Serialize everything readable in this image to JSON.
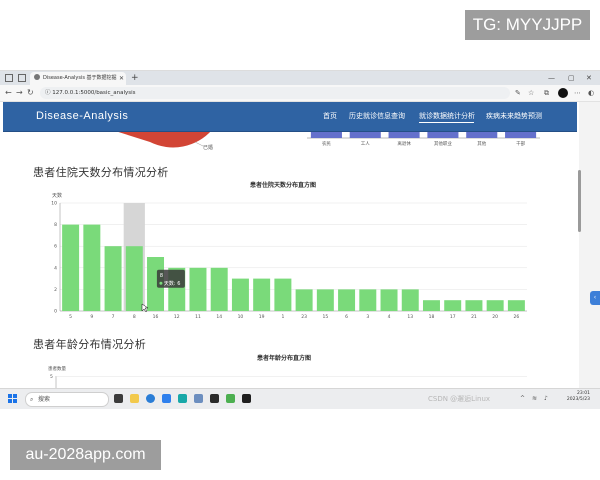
{
  "watermarks": {
    "top": "TG: MYYJJPP",
    "bottom": "au-2028app.com"
  },
  "browser": {
    "tab_title": "Disease-Analysis 基于数据挖掘",
    "url": "127.0.0.1:5000/basic_analysis"
  },
  "navbar": {
    "brand": "Disease-Analysis",
    "links": [
      {
        "label": "首页"
      },
      {
        "label": "历史就诊信息查询"
      },
      {
        "label": "就诊数据统计分析",
        "active": true
      },
      {
        "label": "疾病未来趋势预测"
      }
    ]
  },
  "top_partial": {
    "pie_label": "已婚",
    "bar_categories": [
      "农民",
      "工人",
      "离退休",
      "其他职业",
      "其他",
      "干部"
    ],
    "bar_values": [
      0.4,
      1.0,
      0.5,
      0.5,
      0.5,
      0.3
    ],
    "bar_color": "#6470cc"
  },
  "sections": {
    "stay_title": "患者住院天数分布情况分析",
    "age_title": "患者年龄分布情况分析"
  },
  "chart_data": [
    {
      "type": "bar",
      "title": "患者住院天数分布直方图",
      "ylabel": "天数",
      "categories": [
        "5",
        "9",
        "7",
        "8",
        "16",
        "12",
        "11",
        "14",
        "10",
        "19",
        "1",
        "23",
        "15",
        "6",
        "3",
        "4",
        "13",
        "18",
        "17",
        "21",
        "20",
        "26"
      ],
      "values": [
        8,
        8,
        6,
        6,
        5,
        4,
        4,
        4,
        3,
        3,
        3,
        2,
        2,
        2,
        2,
        2,
        2,
        1,
        1,
        1,
        1,
        1
      ],
      "ylim": [
        0,
        10
      ],
      "yticks": [
        0,
        2,
        4,
        6,
        8,
        10
      ],
      "grid": true,
      "bar_color": "#7ada7a",
      "tooltip": {
        "category": "8",
        "series": "天数",
        "value": 6
      }
    },
    {
      "type": "bar",
      "title": "患者年龄分布直方图",
      "ylabel": "患者数量",
      "yticks": [
        5
      ]
    }
  ],
  "taskbar": {
    "search_placeholder": "搜索",
    "clock_time": "23:01",
    "clock_date": "2023/5/23",
    "csdn": "CSDN @邂逅Linux"
  },
  "colors": {
    "navbar": "#2f63a3",
    "accent": "#3d7fd8"
  }
}
